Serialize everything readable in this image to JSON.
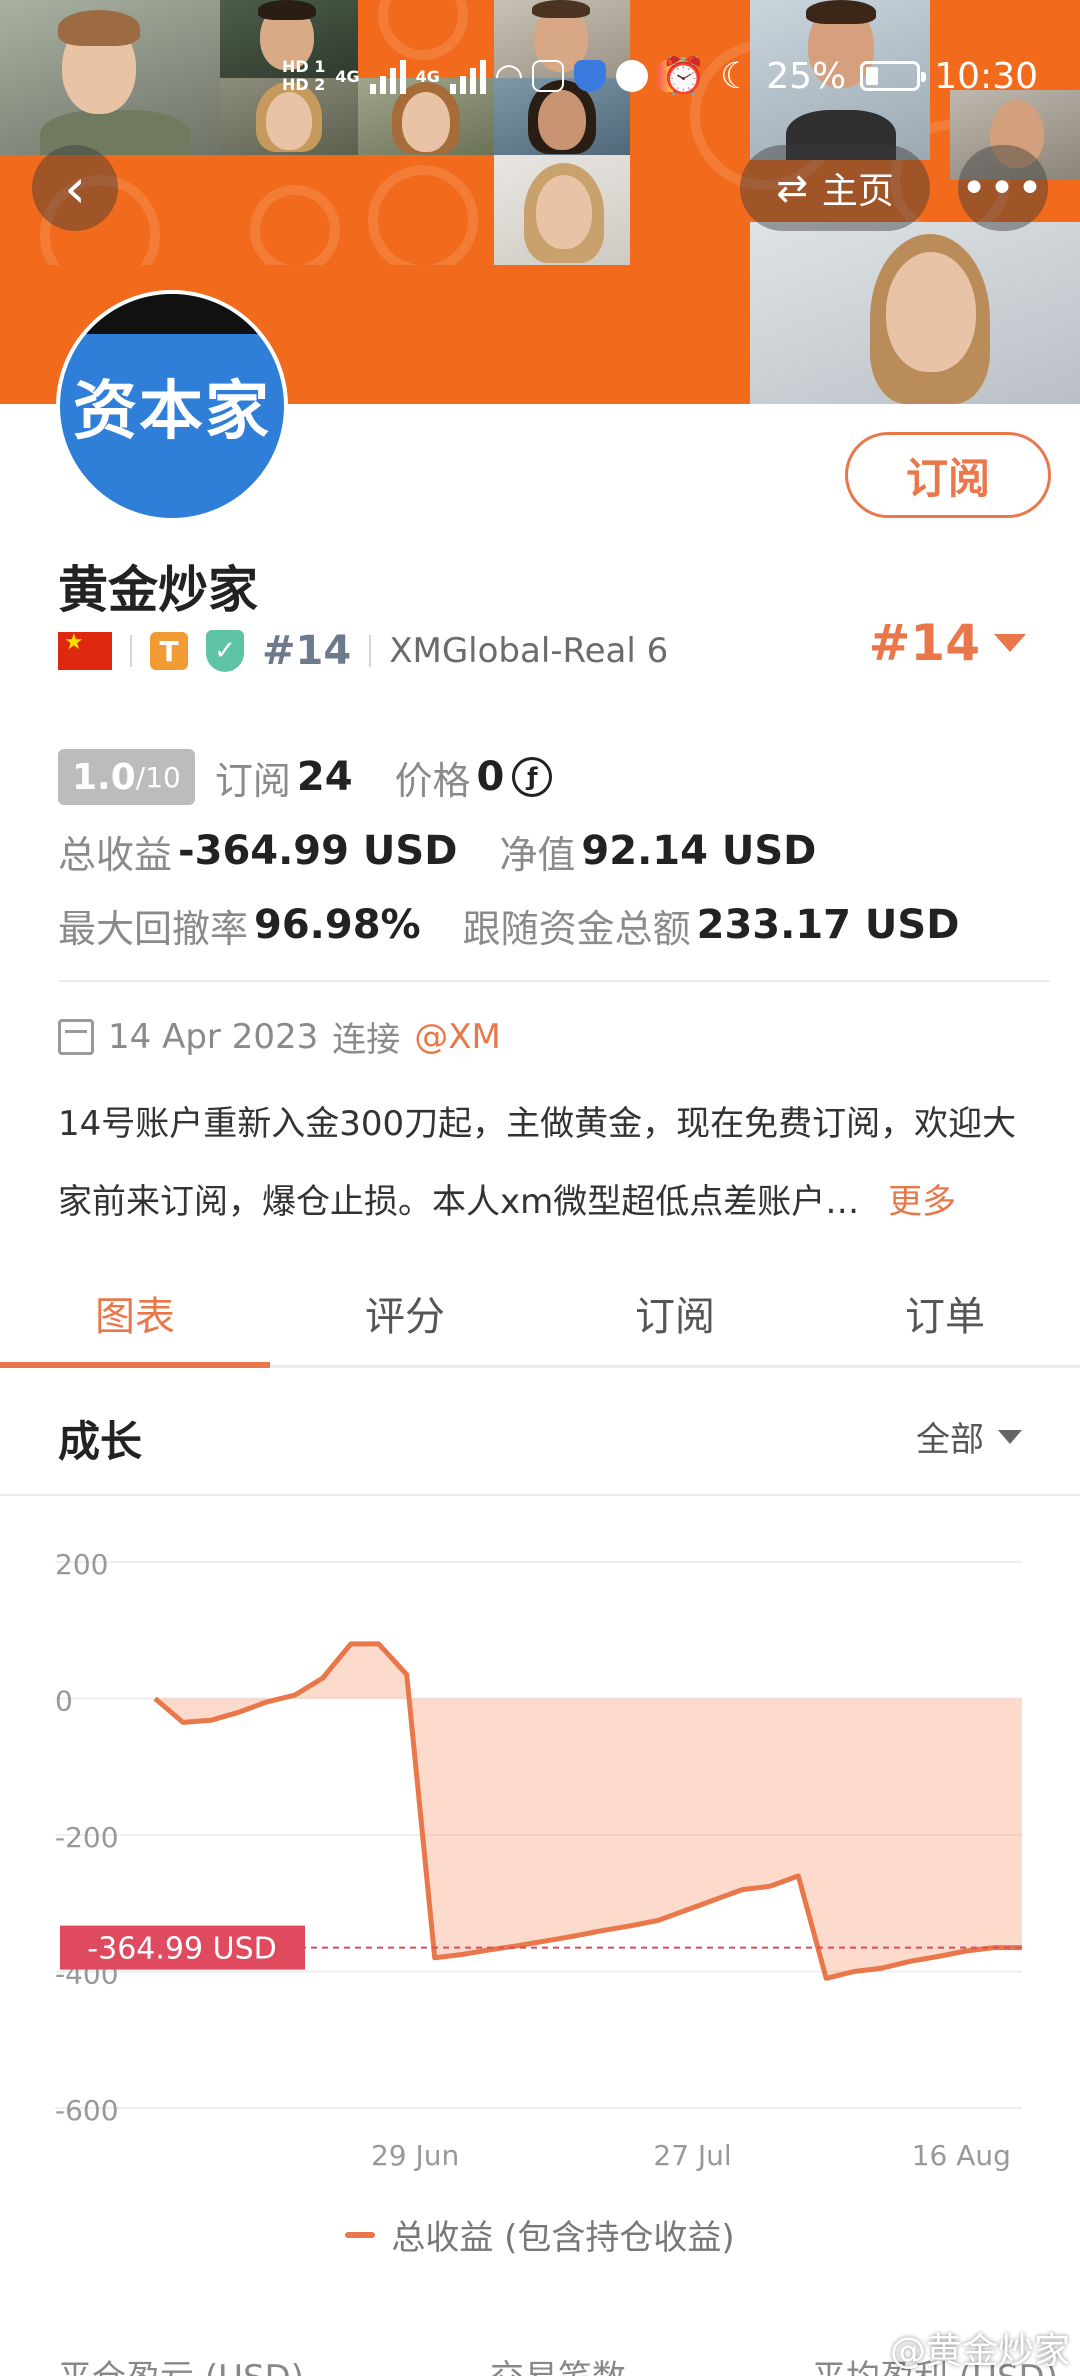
{
  "status_bar": {
    "hd1": "HD 1",
    "hd2": "HD 2",
    "net1": "4G",
    "net2": "4G",
    "battery_pct": "25%",
    "battery_level": 0.25,
    "time": "10:30"
  },
  "header": {
    "back_icon": "back-arrow-icon",
    "home_label": "主页",
    "more_icon": "more-dots-icon"
  },
  "profile": {
    "avatar_text": "资本家",
    "subscribe_label": "订阅",
    "name": "黄金炒家",
    "badge_t": "T",
    "rank": "#14",
    "account": "XMGlobal-Real 6",
    "rank_big": "#14"
  },
  "stats": {
    "score": "1.0",
    "score_max": "/10",
    "subs_label": "订阅",
    "subs_value": "24",
    "price_label": "价格",
    "price_value": "0",
    "price_icon": "ƒ",
    "total_profit_label": "总收益",
    "total_profit_value": "-364.99 USD",
    "equity_label": "净值",
    "equity_value": "92.14 USD",
    "max_dd_label": "最大回撤率",
    "max_dd_value": "96.98%",
    "follow_label": "跟随资金总额",
    "follow_value": "233.17 USD"
  },
  "join": {
    "date": "14 Apr 2023",
    "connect": "连接",
    "broker": "@XM"
  },
  "description": {
    "text": "14号账户重新入金300刀起，主做黄金，现在免费订阅，欢迎大家前来订阅，爆仓止损。本人xm微型超低点差账户…",
    "more": "更多"
  },
  "tabs": [
    {
      "label": "图表",
      "active": true
    },
    {
      "label": "评分",
      "active": false
    },
    {
      "label": "订阅",
      "active": false
    },
    {
      "label": "订单",
      "active": false
    }
  ],
  "section": {
    "title": "成长",
    "range": "全部"
  },
  "chart_data": {
    "type": "area",
    "y_ticks": [
      "200",
      "0",
      "-200",
      "-400",
      "-600"
    ],
    "ylim": [
      -600,
      200
    ],
    "x_ticks": [
      "29 Jun",
      "27 Jul",
      "16 Aug"
    ],
    "current_label": "-364.99 USD",
    "current_value": -364.99,
    "series": [
      {
        "name": "总收益 (包含持仓收益)",
        "color": "#e9774a",
        "values": [
          0,
          -35,
          -32,
          -20,
          -5,
          5,
          30,
          80,
          80,
          35,
          -380,
          -375,
          -368,
          -362,
          -355,
          -348,
          -340,
          -333,
          -325,
          -310,
          -295,
          -280,
          -275,
          -260,
          -410,
          -400,
          -395,
          -385,
          -378,
          -370,
          -365,
          -364.99
        ]
      }
    ]
  },
  "legend": {
    "label": "总收益 (包含持仓收益)"
  },
  "bottom": {
    "col1": "平仓盈亏 (USD)",
    "col2": "交易笔数",
    "col3": "平均盈利 (USD)"
  },
  "watermark": "@黄金炒家"
}
